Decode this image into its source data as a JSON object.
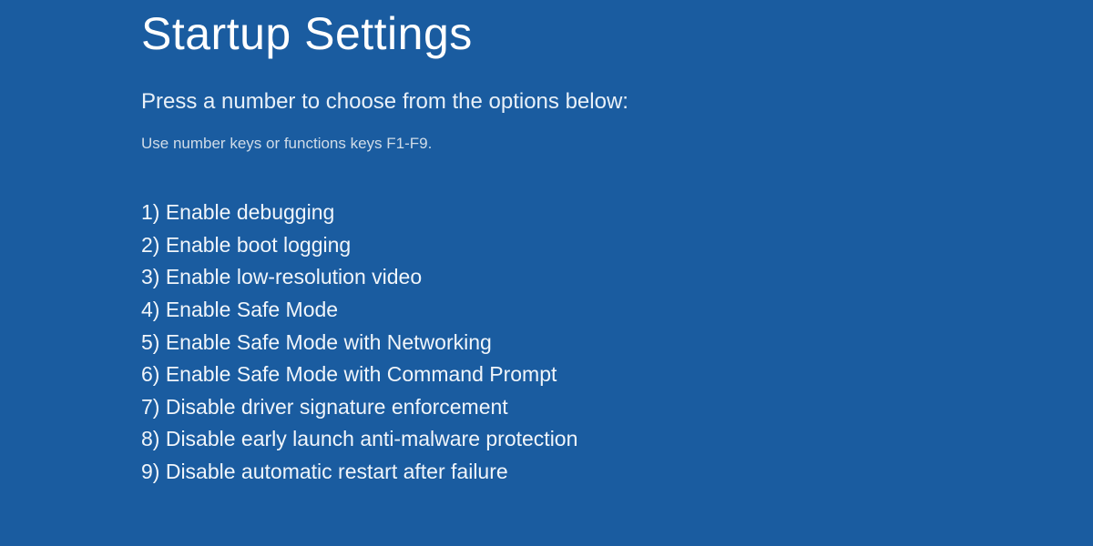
{
  "title": "Startup Settings",
  "instruction": "Press a number to choose from the options below:",
  "hint": "Use number keys or functions keys F1-F9.",
  "options": [
    "1) Enable debugging",
    "2) Enable boot logging",
    "3) Enable low-resolution video",
    "4) Enable Safe Mode",
    "5) Enable Safe Mode with Networking",
    "6) Enable Safe Mode with Command Prompt",
    "7) Disable driver signature enforcement",
    "8) Disable early launch anti-malware protection",
    "9) Disable automatic restart after failure"
  ],
  "colors": {
    "background": "#1a5ca0",
    "text_primary": "#ffffff",
    "text_secondary": "#d0dce8"
  }
}
